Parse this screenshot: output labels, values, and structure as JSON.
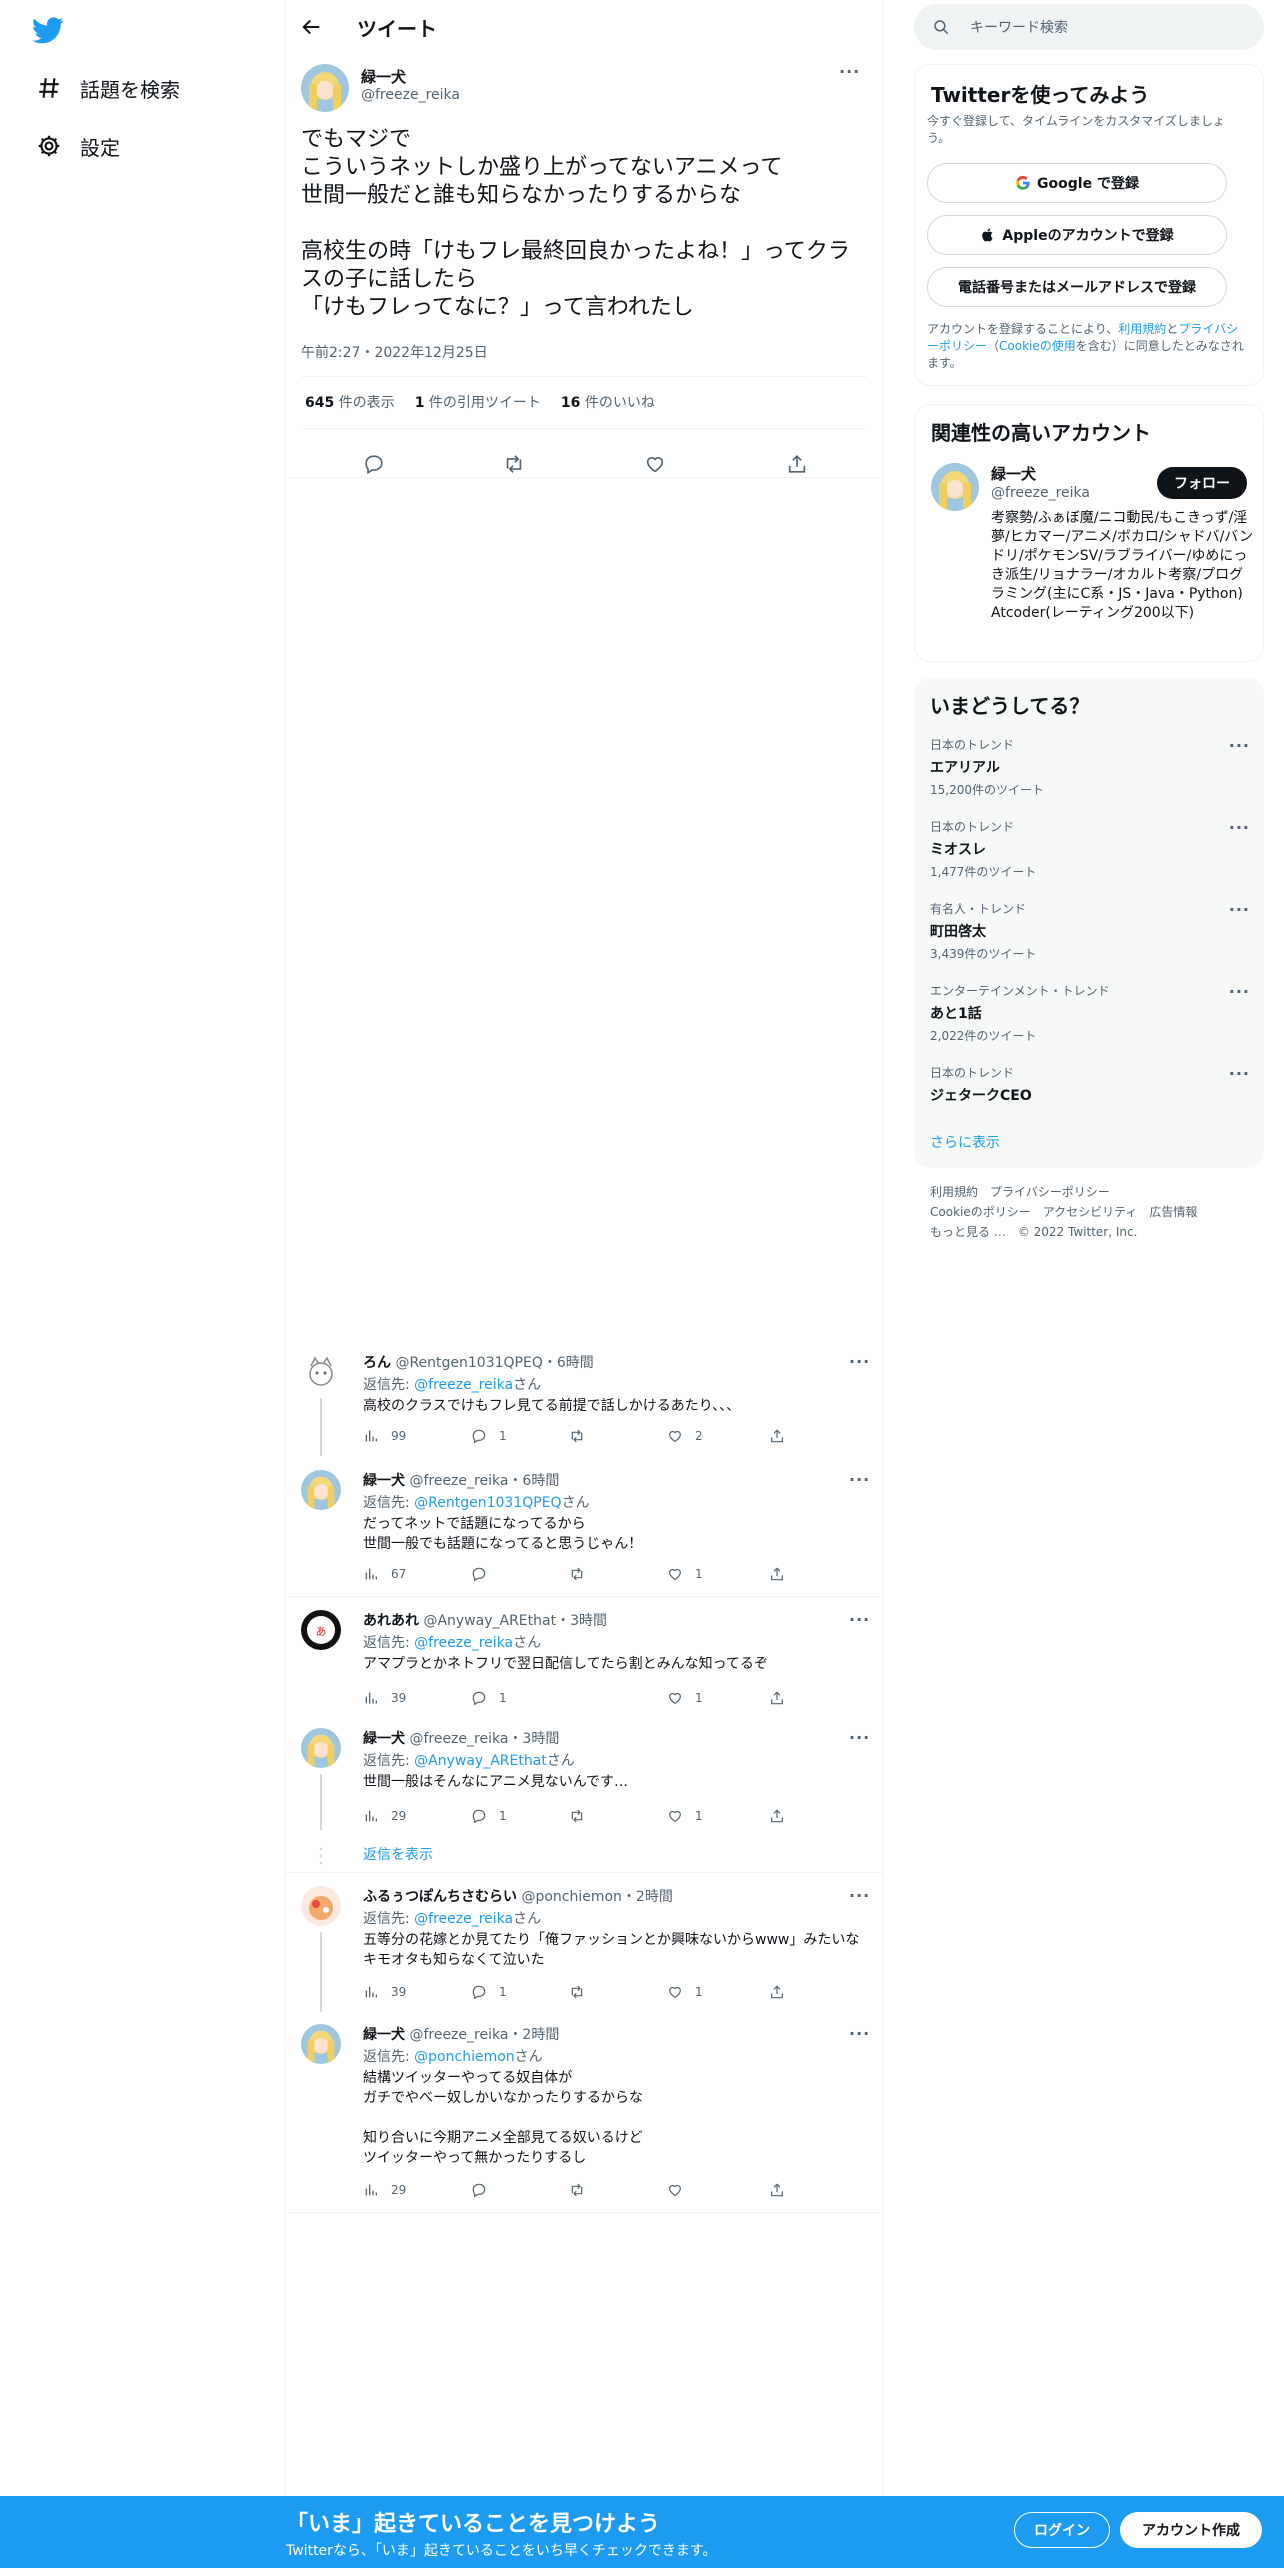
{
  "nav": {
    "items": [
      {
        "label": "話題を検索",
        "icon": "hashtag-icon"
      },
      {
        "label": "設定",
        "icon": "gear-icon"
      }
    ]
  },
  "header": {
    "title": "ツイート"
  },
  "main_tweet": {
    "name": "緑一犬",
    "handle": "@freeze_reika",
    "text": "でもマジで\nこういうネットしか盛り上がってないアニメって\n世間一般だと誰も知らなかったりするからな\n\n高校生の時「けもフレ最終回良かったよね！」ってクラスの子に話したら\n「けもフレってなに？」って言われたし",
    "time": "午前2:27・2022年12月25日",
    "views_count": "645",
    "views_label": "件の表示",
    "quotes_count": "1",
    "quotes_label": "件の引用ツイート",
    "likes_count": "16",
    "likes_label": "件のいいね"
  },
  "replies": [
    {
      "name": "ろん",
      "handle": "@Rentgen1031QPEQ",
      "time": "・6時間",
      "to_prefix": "返信先: ",
      "to": "@freeze_reika",
      "to_suffix": "さん",
      "text": "高校のクラスでけもフレ見てる前提で話しかけるあたり、、、",
      "views": "99",
      "replies": "1",
      "retweets": "",
      "likes": "2"
    },
    {
      "name": "緑一犬",
      "handle": "@freeze_reika",
      "time": "・6時間",
      "to_prefix": "返信先: ",
      "to": "@Rentgen1031QPEQ",
      "to_suffix": "さん",
      "text": "だってネットで話題になってるから\n世間一般でも話題になってると思うじゃん！",
      "views": "67",
      "replies": "",
      "retweets": "",
      "likes": "1"
    },
    {
      "name": "あれあれ",
      "handle": "@Anyway_AREthat",
      "time": "・3時間",
      "to_prefix": "返信先: ",
      "to": "@freeze_reika",
      "to_suffix": "さん",
      "text": "アマプラとかネトフリで翌日配信してたら割とみんな知ってるぞ",
      "views": "39",
      "replies": "1",
      "retweets": "",
      "likes": "1"
    },
    {
      "name": "緑一犬",
      "handle": "@freeze_reika",
      "time": "・3時間",
      "to_prefix": "返信先: ",
      "to": "@Anyway_AREthat",
      "to_suffix": "さん",
      "text": "世間一般はそんなにアニメ見ないんです…",
      "views": "29",
      "replies": "1",
      "retweets": "",
      "likes": "1"
    },
    {
      "name": "ふるぅつぽんちさむらい",
      "handle": "@ponchiemon",
      "time": "・2時間",
      "to_prefix": "返信先: ",
      "to": "@freeze_reika",
      "to_suffix": "さん",
      "text": "五等分の花嫁とか見てたり「俺ファッションとか興味ないからwww」みたいなキモオタも知らなくて泣いた",
      "views": "39",
      "replies": "1",
      "retweets": "",
      "likes": "1"
    },
    {
      "name": "緑一犬",
      "handle": "@freeze_reika",
      "time": "・2時間",
      "to_prefix": "返信先: ",
      "to": "@ponchiemon",
      "to_suffix": "さん",
      "text": "結構ツイッターやってる奴自体が\nガチでやべー奴しかいなかったりするからな\n\n知り合いに今期アニメ全部見てる奴いるけど\nツイッターやって無かったりするし",
      "views": "29",
      "replies": "",
      "retweets": "",
      "likes": ""
    }
  ],
  "show_replies": "返信を表示",
  "search": {
    "placeholder": "キーワード検索"
  },
  "signup_card": {
    "title": "Twitterを使ってみよう",
    "subtitle": "今すぐ登録して、タイムラインをカスタマイズしましょう。",
    "google": "Google で登録",
    "apple": "Appleのアカウントで登録",
    "phone": "電話番号またはメールアドレスで登録",
    "terms_a": "アカウントを登録することにより、",
    "terms_link1": "利用規約",
    "terms_b": "と",
    "terms_link2": "プライバシーポリシー",
    "terms_c": "（",
    "terms_link3": "Cookieの使用",
    "terms_d": "を含む）に同意したとみなされます。"
  },
  "related": {
    "title": "関連性の高いアカウント",
    "name": "緑一犬",
    "handle": "@freeze_reika",
    "follow": "フォロー",
    "bio": "考察勢/ふぁぼ魔/ニコ動民/もこきっず/淫夢/ヒカマー/アニメ/ボカロ/シャドバ/バンドリ/ポケモンSV/ラブライバー/ゆめにっき派生/リョナラー/オカルト考察/プログラミング(主にC系・JS・Java・Python) Atcoder(レーティング200以下)"
  },
  "trends": {
    "title": "いまどうしてる？",
    "items": [
      {
        "context": "日本のトレンド",
        "name": "エアリアル",
        "count": "15,200件のツイート"
      },
      {
        "context": "日本のトレンド",
        "name": "ミオスレ",
        "count": "1,477件のツイート"
      },
      {
        "context": "有名人・トレンド",
        "name": "町田啓太",
        "count": "3,439件のツイート"
      },
      {
        "context": "エンターテインメント・トレンド",
        "name": "あと1話",
        "count": "2,022件のツイート"
      },
      {
        "context": "日本のトレンド",
        "name": "ジェタークCEO",
        "count": ""
      }
    ],
    "show_more": "さらに表示"
  },
  "footer": {
    "links": [
      "利用規約",
      "プライバシーポリシー",
      "Cookieのポリシー",
      "アクセシビリティ",
      "広告情報",
      "もっと見る …",
      "© 2022 Twitter, Inc."
    ]
  },
  "banner": {
    "title": "「いま」起きていることを見つけよう",
    "subtitle": "Twitterなら、「いま」起きていることをいち早くチェックできます。",
    "login": "ログイン",
    "signup": "アカウント作成"
  },
  "colors": {
    "accent": "#1d9bf0",
    "text": "#0f1419",
    "muted": "#536471"
  }
}
